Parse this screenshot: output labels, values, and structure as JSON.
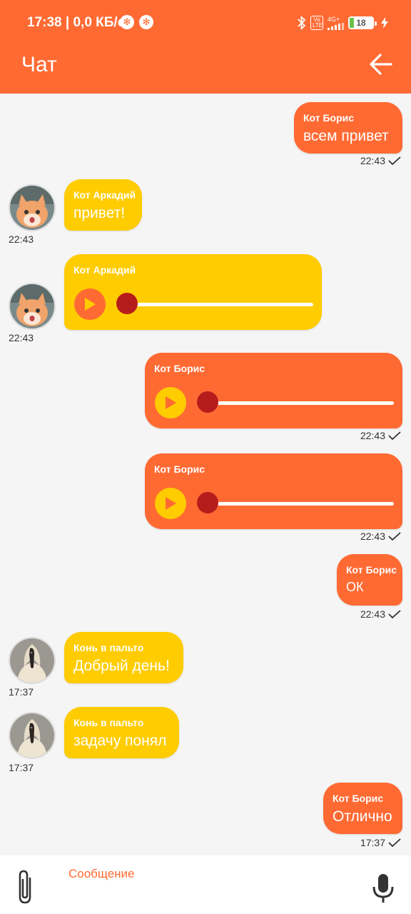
{
  "status_bar": {
    "time_speed": "17:38 | 0,0 КБ/с",
    "volte": "Vo LTE",
    "network": "4G+",
    "battery": "18"
  },
  "app_bar": {
    "title": "Чат",
    "back_icon": "arrow-left-icon"
  },
  "colors": {
    "accent": "#ff6a33",
    "incoming": "#ffcc00",
    "thumb": "#b71c1c"
  },
  "messages": [
    {
      "direction": "out",
      "sender": "Кот Борис",
      "type": "text",
      "text": "всем привет",
      "time": "22:43"
    },
    {
      "direction": "in",
      "sender": "Кот Аркадий",
      "type": "text",
      "text": "привет!",
      "time": "22:43"
    },
    {
      "direction": "in",
      "sender": "Кот Аркадий",
      "type": "voice",
      "time": "22:43"
    },
    {
      "direction": "out",
      "sender": "Кот Борис",
      "type": "voice",
      "time": "22:43"
    },
    {
      "direction": "out",
      "sender": "Кот Борис",
      "type": "voice",
      "time": "22:43"
    },
    {
      "direction": "out",
      "sender": "Кот Борис",
      "type": "text",
      "text": "ОК",
      "time": "22:43"
    },
    {
      "direction": "in",
      "sender": "Конь в пальто",
      "type": "text",
      "text": "Добрый день!",
      "time": "17:37"
    },
    {
      "direction": "in",
      "sender": "Конь в пальто",
      "type": "text",
      "text": "задачу понял",
      "time": "17:37"
    },
    {
      "direction": "out",
      "sender": "Кот Борис",
      "type": "text",
      "text": "Отлично",
      "time": "17:37"
    }
  ],
  "input_bar": {
    "placeholder": "Сообщение",
    "attach_icon": "paperclip-icon",
    "mic_icon": "microphone-icon"
  }
}
